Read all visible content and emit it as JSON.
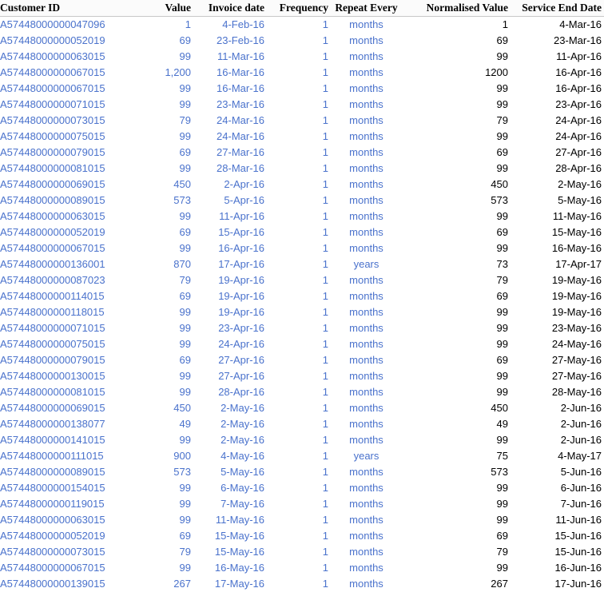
{
  "table": {
    "columns": [
      {
        "key": "customer_id",
        "label": "Customer ID",
        "align": "left",
        "color": "blue"
      },
      {
        "key": "value",
        "label": "Value",
        "align": "right",
        "color": "blue"
      },
      {
        "key": "invoice_date",
        "label": "Invoice date",
        "align": "right",
        "color": "blue"
      },
      {
        "key": "frequency",
        "label": "Frequency",
        "align": "right",
        "color": "blue"
      },
      {
        "key": "repeat_every",
        "label": "Repeat Every",
        "align": "center",
        "color": "blue"
      },
      {
        "key": "normalised_value",
        "label": "Normalised Value",
        "align": "right",
        "color": "black"
      },
      {
        "key": "service_end_date",
        "label": "Service End Date",
        "align": "right",
        "color": "black"
      }
    ],
    "rows": [
      [
        "A57448000000047096",
        "1",
        "4-Feb-16",
        "1",
        "months",
        "1",
        "4-Mar-16"
      ],
      [
        "A57448000000052019",
        "69",
        "23-Feb-16",
        "1",
        "months",
        "69",
        "23-Mar-16"
      ],
      [
        "A57448000000063015",
        "99",
        "11-Mar-16",
        "1",
        "months",
        "99",
        "11-Apr-16"
      ],
      [
        "A57448000000067015",
        "1,200",
        "16-Mar-16",
        "1",
        "months",
        "1200",
        "16-Apr-16"
      ],
      [
        "A57448000000067015",
        "99",
        "16-Mar-16",
        "1",
        "months",
        "99",
        "16-Apr-16"
      ],
      [
        "A57448000000071015",
        "99",
        "23-Mar-16",
        "1",
        "months",
        "99",
        "23-Apr-16"
      ],
      [
        "A57448000000073015",
        "79",
        "24-Mar-16",
        "1",
        "months",
        "79",
        "24-Apr-16"
      ],
      [
        "A57448000000075015",
        "99",
        "24-Mar-16",
        "1",
        "months",
        "99",
        "24-Apr-16"
      ],
      [
        "A57448000000079015",
        "69",
        "27-Mar-16",
        "1",
        "months",
        "69",
        "27-Apr-16"
      ],
      [
        "A57448000000081015",
        "99",
        "28-Mar-16",
        "1",
        "months",
        "99",
        "28-Apr-16"
      ],
      [
        "A57448000000069015",
        "450",
        "2-Apr-16",
        "1",
        "months",
        "450",
        "2-May-16"
      ],
      [
        "A57448000000089015",
        "573",
        "5-Apr-16",
        "1",
        "months",
        "573",
        "5-May-16"
      ],
      [
        "A57448000000063015",
        "99",
        "11-Apr-16",
        "1",
        "months",
        "99",
        "11-May-16"
      ],
      [
        "A57448000000052019",
        "69",
        "15-Apr-16",
        "1",
        "months",
        "69",
        "15-May-16"
      ],
      [
        "A57448000000067015",
        "99",
        "16-Apr-16",
        "1",
        "months",
        "99",
        "16-May-16"
      ],
      [
        "A57448000000136001",
        "870",
        "17-Apr-16",
        "1",
        "years",
        "73",
        "17-Apr-17"
      ],
      [
        "A57448000000087023",
        "79",
        "19-Apr-16",
        "1",
        "months",
        "79",
        "19-May-16"
      ],
      [
        "A57448000000114015",
        "69",
        "19-Apr-16",
        "1",
        "months",
        "69",
        "19-May-16"
      ],
      [
        "A57448000000118015",
        "99",
        "19-Apr-16",
        "1",
        "months",
        "99",
        "19-May-16"
      ],
      [
        "A57448000000071015",
        "99",
        "23-Apr-16",
        "1",
        "months",
        "99",
        "23-May-16"
      ],
      [
        "A57448000000075015",
        "99",
        "24-Apr-16",
        "1",
        "months",
        "99",
        "24-May-16"
      ],
      [
        "A57448000000079015",
        "69",
        "27-Apr-16",
        "1",
        "months",
        "69",
        "27-May-16"
      ],
      [
        "A57448000000130015",
        "99",
        "27-Apr-16",
        "1",
        "months",
        "99",
        "27-May-16"
      ],
      [
        "A57448000000081015",
        "99",
        "28-Apr-16",
        "1",
        "months",
        "99",
        "28-May-16"
      ],
      [
        "A57448000000069015",
        "450",
        "2-May-16",
        "1",
        "months",
        "450",
        "2-Jun-16"
      ],
      [
        "A57448000000138077",
        "49",
        "2-May-16",
        "1",
        "months",
        "49",
        "2-Jun-16"
      ],
      [
        "A57448000000141015",
        "99",
        "2-May-16",
        "1",
        "months",
        "99",
        "2-Jun-16"
      ],
      [
        "A57448000000111015",
        "900",
        "4-May-16",
        "1",
        "years",
        "75",
        "4-May-17"
      ],
      [
        "A57448000000089015",
        "573",
        "5-May-16",
        "1",
        "months",
        "573",
        "5-Jun-16"
      ],
      [
        "A57448000000154015",
        "99",
        "6-May-16",
        "1",
        "months",
        "99",
        "6-Jun-16"
      ],
      [
        "A57448000000119015",
        "99",
        "7-May-16",
        "1",
        "months",
        "99",
        "7-Jun-16"
      ],
      [
        "A57448000000063015",
        "99",
        "11-May-16",
        "1",
        "months",
        "99",
        "11-Jun-16"
      ],
      [
        "A57448000000052019",
        "69",
        "15-May-16",
        "1",
        "months",
        "69",
        "15-Jun-16"
      ],
      [
        "A57448000000073015",
        "79",
        "15-May-16",
        "1",
        "months",
        "79",
        "15-Jun-16"
      ],
      [
        "A57448000000067015",
        "99",
        "16-May-16",
        "1",
        "months",
        "99",
        "16-Jun-16"
      ],
      [
        "A57448000000139015",
        "267",
        "17-May-16",
        "1",
        "months",
        "267",
        "17-Jun-16"
      ]
    ]
  },
  "theme": {
    "link_blue": "#4a72cc",
    "text_black": "#000000",
    "header_rule": "#c8c8c8",
    "header_bg": "#fbfbfb"
  }
}
